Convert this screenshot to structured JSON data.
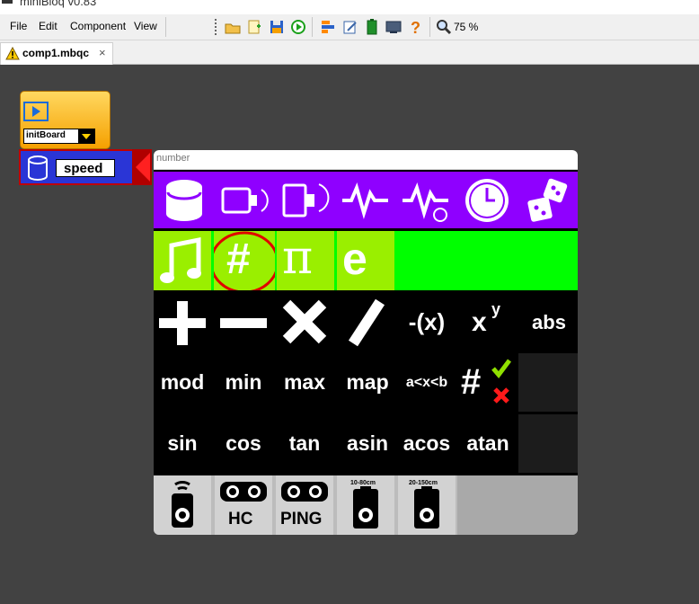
{
  "window": {
    "title": "miniBloq v0.83"
  },
  "menu": {
    "items": [
      "File",
      "Edit",
      "Component",
      "View"
    ]
  },
  "toolbar": {
    "icons": [
      "open-folder-icon",
      "new-file-icon",
      "save-icon",
      "run-icon",
      "block-icon",
      "edit-icon",
      "battery-icon",
      "terminal-icon",
      "help-icon",
      "zoom-icon"
    ],
    "zoom_label": "75 %"
  },
  "tab": {
    "label": "comp1.mbqc",
    "close": "×"
  },
  "canvas": {
    "init_bloq": {
      "select_value": "initBoard"
    },
    "variable_bloq": {
      "name": "speed"
    }
  },
  "picker": {
    "search_placeholder": "number",
    "category_icons": [
      "database-icon",
      "motor-icon",
      "servo-icon",
      "signal-icon",
      "signal-timer-icon",
      "clock-icon",
      "dice-icon"
    ],
    "constant_icons": [
      "music-note-icon",
      "number-icon",
      "pi-icon",
      "euler-icon"
    ],
    "constant_labels": {
      "number": "#",
      "pi": "π",
      "euler": "e"
    },
    "operators_row1": [
      "+",
      "−",
      "×",
      "/",
      "-(x)",
      "x",
      "abs"
    ],
    "power_superscript": "y",
    "operators_row2": [
      "mod",
      "min",
      "max",
      "map",
      "a<x<b"
    ],
    "number_check_label": "#",
    "operators_row3": [
      "sin",
      "cos",
      "tan",
      "asin",
      "acos",
      "atan"
    ],
    "sensors": [
      {
        "icon": "ir-remote-icon",
        "label": ""
      },
      {
        "icon": "ultrasonic-icon",
        "label": "HC"
      },
      {
        "icon": "ultrasonic-icon",
        "label": "PING"
      },
      {
        "icon": "distance-sensor-icon",
        "label": "10-80cm"
      },
      {
        "icon": "distance-sensor-icon",
        "label": "20-150cm"
      }
    ],
    "colors": {
      "category_row": "#8f00ff",
      "constants_row": "#00ff00",
      "selected_highlight": "#ff0000"
    }
  }
}
